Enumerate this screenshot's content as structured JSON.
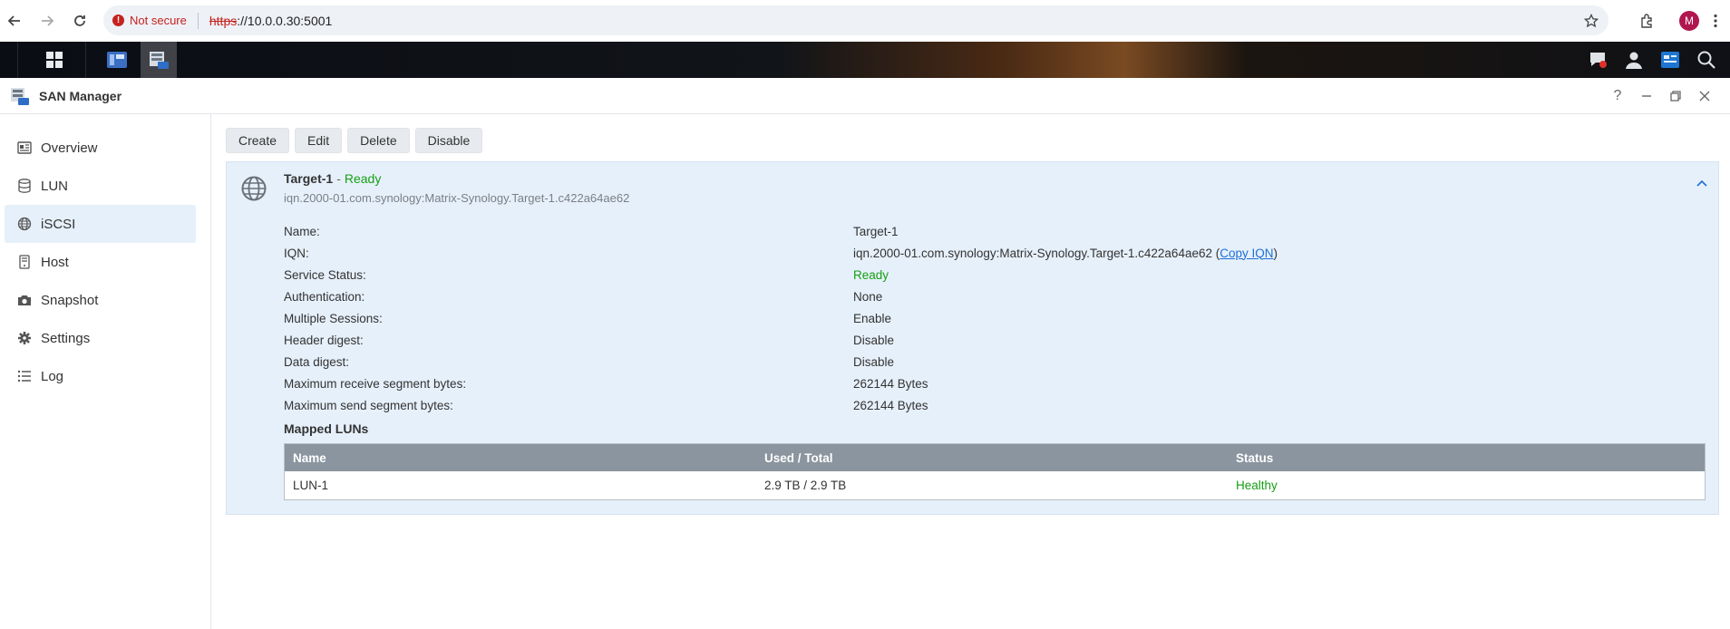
{
  "browser": {
    "security_label": "Not secure",
    "url_scheme": "https",
    "url_rest": "://10.0.0.30:5001",
    "profile_initial": "M"
  },
  "window": {
    "title": "SAN Manager"
  },
  "sidebar": {
    "items": [
      {
        "label": "Overview",
        "icon": "overview-icon"
      },
      {
        "label": "LUN",
        "icon": "database-icon"
      },
      {
        "label": "iSCSI",
        "icon": "globe-icon",
        "selected": true
      },
      {
        "label": "Host",
        "icon": "host-icon"
      },
      {
        "label": "Snapshot",
        "icon": "camera-icon"
      },
      {
        "label": "Settings",
        "icon": "gear-icon"
      },
      {
        "label": "Log",
        "icon": "list-icon"
      }
    ]
  },
  "toolbar": {
    "create": "Create",
    "edit": "Edit",
    "delete": "Delete",
    "disable": "Disable"
  },
  "target": {
    "name": "Target-1",
    "separator": "-",
    "status": "Ready",
    "iqn": "iqn.2000-01.com.synology:Matrix-Synology.Target-1.c422a64ae62",
    "properties": [
      {
        "label": "Name:",
        "value": "Target-1"
      },
      {
        "label": "IQN:",
        "value": "iqn.2000-01.com.synology:Matrix-Synology.Target-1.c422a64ae62"
      },
      {
        "label": "Service Status:",
        "value": "Ready"
      },
      {
        "label": "Authentication:",
        "value": "None"
      },
      {
        "label": "Multiple Sessions:",
        "value": "Enable"
      },
      {
        "label": "Header digest:",
        "value": "Disable"
      },
      {
        "label": "Data digest:",
        "value": "Disable"
      },
      {
        "label": "Maximum receive segment bytes:",
        "value": "262144 Bytes"
      },
      {
        "label": "Maximum send segment bytes:",
        "value": "262144 Bytes"
      }
    ],
    "copy_iqn": "Copy IQN",
    "mapped_title": "Mapped LUNs",
    "table": {
      "headers": [
        "Name",
        "Used / Total",
        "Status"
      ],
      "rows": [
        {
          "name": "LUN-1",
          "used_total": "2.9 TB / 2.9 TB",
          "status": "Healthy"
        }
      ]
    }
  },
  "colors": {
    "accent": "#1e6fd9",
    "ok": "#16a016",
    "panel": "#e6f0fa"
  }
}
